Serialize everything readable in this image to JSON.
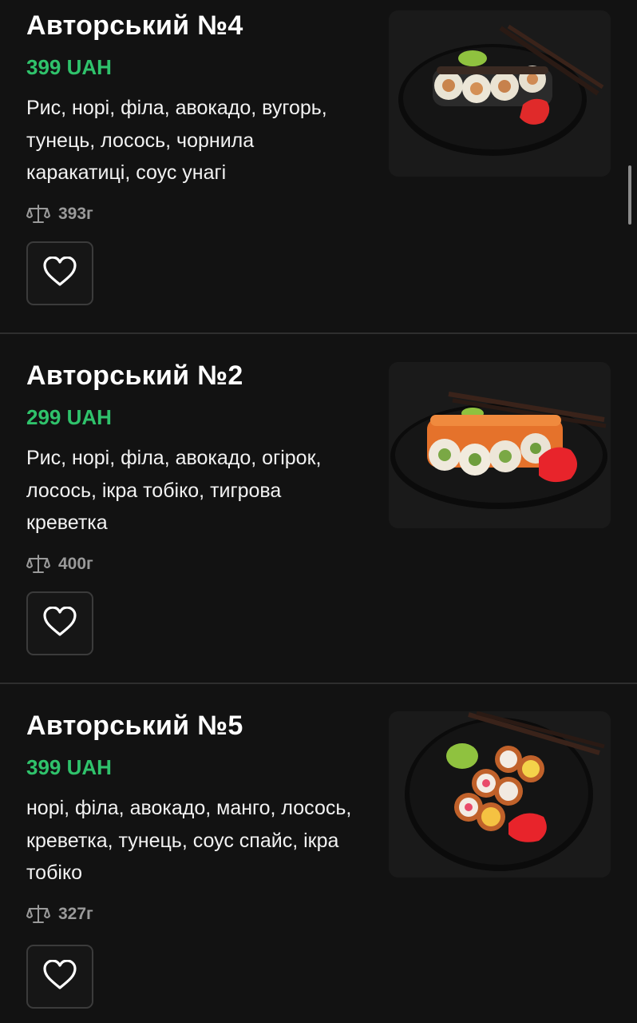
{
  "products": [
    {
      "title": "Авторський №4",
      "price": "399 UAH",
      "description": "Рис, норі, філа, авокадо, вугорь, тунець, лосось, чорнила каракатиці, соус унагі",
      "weight": "393г",
      "image_icon": "sushi-roll-image"
    },
    {
      "title": "Авторський №2",
      "price": "299 UAH",
      "description": "Рис, норі, філа, авокадо, огірок, лосось, ікра тобіко, тигрова креветка",
      "weight": "400г",
      "image_icon": "sushi-roll-image"
    },
    {
      "title": "Авторський №5",
      "price": "399 UAH",
      "description": "норі, філа, авокадо, манго, лосось, креветка, тунець, соус спайс, ікра тобіко",
      "weight": "327г",
      "image_icon": "sushi-roll-image"
    }
  ],
  "colors": {
    "background": "#121212",
    "price": "#2fc26b",
    "divider": "#2e2e2e",
    "muted": "#9a9a9a"
  }
}
